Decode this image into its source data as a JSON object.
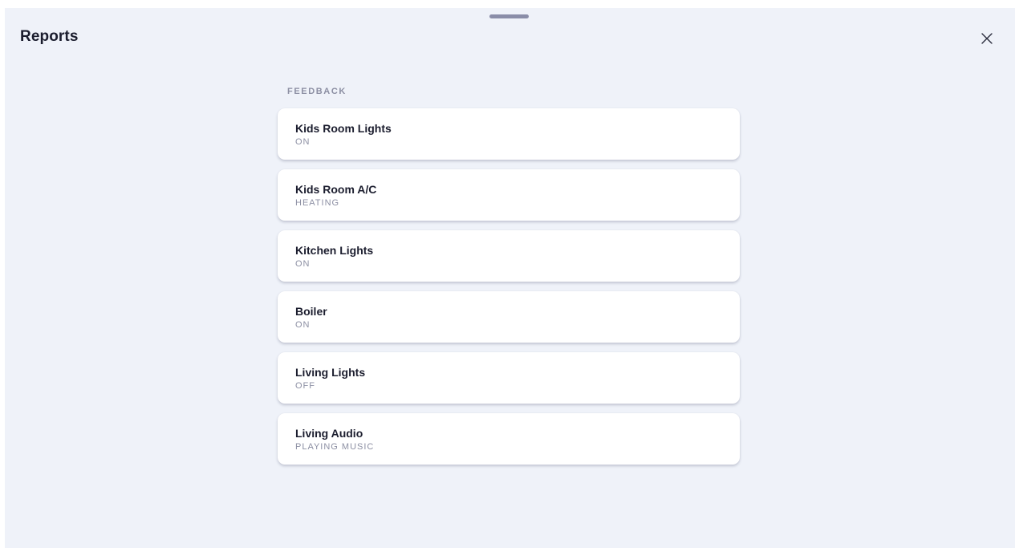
{
  "header": {
    "title": "Reports",
    "close_icon": "close-icon"
  },
  "section": {
    "label": "FEEDBACK"
  },
  "reports": [
    {
      "name": "Kids Room Lights",
      "status": "ON"
    },
    {
      "name": "Kids Room A/C",
      "status": "HEATING"
    },
    {
      "name": "Kitchen Lights",
      "status": "ON"
    },
    {
      "name": "Boiler",
      "status": "ON"
    },
    {
      "name": "Living Lights",
      "status": "OFF"
    },
    {
      "name": "Living Audio",
      "status": "PLAYING MUSIC"
    }
  ],
  "colors": {
    "background": "#eff2f9",
    "card": "#ffffff",
    "title": "#1b1d2e",
    "muted": "#8c8fa3",
    "handle": "#8a8da8"
  }
}
